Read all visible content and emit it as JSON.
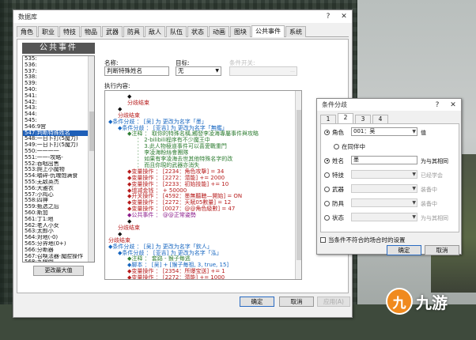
{
  "main_window": {
    "title": "数据库",
    "tabs": [
      "角色",
      "职业",
      "特技",
      "物品",
      "武器",
      "防具",
      "敌人",
      "队伍",
      "状态",
      "动画",
      "图块",
      "公共事件",
      "系统"
    ],
    "selected_tab": "公共事件",
    "list_header": "公共事件",
    "list_items": [
      "535:",
      "536:",
      "537:",
      "538:",
      "539:",
      "540:",
      "541:",
      "542:",
      "543:",
      "544:",
      "545:",
      "546:9宫",
      "547:判断特殊姓名",
      "548:一日卜打(5魔力)",
      "549:一日卜打(5魔力)",
      "550:一一一一",
      "551:一一-攻略-",
      "552:吞咽出售",
      "553:爬上小魔物",
      "554:嚼碎-仇魂饱满食",
      "555:无敌英杰",
      "556:大雅衣",
      "557:小鸡心",
      "558:四神",
      "559:甄选之后",
      "560:斯加",
      "561:丁1:地",
      "562:老人小女",
      "563:太郎小",
      "564:对地(-0)",
      "565:分界地(0+)",
      "566:分断器",
      "567:召唤法器·魔腔操作",
      "568:九曜倒",
      "569:尖原",
      "570:星图敏感",
      "571:宇宙之外人院",
      "572:中化·小阵",
      "573:倍然野宽用"
    ],
    "selected_list_index": 12,
    "change_max_label": "更改最大值",
    "name_label": "名称:",
    "name_value": "判断特殊姓名",
    "trigger_label": "目标:",
    "trigger_value": "无",
    "switch_label": "条件开关:",
    "content_label": "执行内容:",
    "code_lines": [
      {
        "t": "◆",
        "c": "#111",
        "i": 4
      },
      {
        "t": "分歧结束",
        "c": "#b71c1c",
        "i": 4
      },
      {
        "t": "◆",
        "c": "#111",
        "i": 2
      },
      {
        "t": "分歧结束",
        "c": "#b71c1c",
        "i": 2
      },
      {
        "t": "◆条件分歧 ： [吴] 为 更改为名字「墨」",
        "c": "#1565c0",
        "i": 0
      },
      {
        "t": "◆条件分歧 ： [亚吉] 为 更改为名字「無艦」",
        "c": "#1565c0",
        "i": 2
      },
      {
        "t": "◆注释 ： 取你的特殊名稱,觸發李凌海專屬事件與攻略",
        "c": "#2e7d32",
        "i": 4
      },
      {
        "t": "： 2-bilibili程序有不少魔王中",
        "c": "#2e7d32",
        "i": 6
      },
      {
        "t": "： 3.此人物極道事件可以喜愛戰重門",
        "c": "#2e7d32",
        "i": 6
      },
      {
        "t": "： 李凌海粉絲會團隊",
        "c": "#2e7d32",
        "i": 6
      },
      {
        "t": "： 如果有李凌海去世其他特殊名字的改",
        "c": "#2e7d32",
        "i": 6
      },
      {
        "t": "： 而且你現的武器亦消失",
        "c": "#2e7d32",
        "i": 6
      },
      {
        "t": "◆变量操作 ： [2234：角色攻撃] = 34",
        "c": "#b71c1c",
        "i": 4
      },
      {
        "t": "◆变量操作 ： [2272：潜能] += 2000",
        "c": "#b71c1c",
        "i": 4
      },
      {
        "t": "◆变量操作 ： [2233：初始技能] += 10",
        "c": "#b71c1c",
        "i": 4
      },
      {
        "t": "◆增减金钱 ： + 50000",
        "c": "#b71c1c",
        "i": 4
      },
      {
        "t": "◆开关操作 ： [4592：墨無聽聴—開始] = ON",
        "c": "#b71c1c",
        "i": 4
      },
      {
        "t": "◆变量操作 ： [2272：天賦05數量] = 12",
        "c": "#b71c1c",
        "i": 4
      },
      {
        "t": "◆变量操作 ： [0027：@@角色級數] = 47",
        "c": "#b71c1c",
        "i": 4
      },
      {
        "t": "◆公共事件 ： @@正常姿勢",
        "c": "#8b1a8b",
        "i": 4
      },
      {
        "t": "◆",
        "c": "#111",
        "i": 4
      },
      {
        "t": "分歧结束",
        "c": "#b71c1c",
        "i": 2
      },
      {
        "t": "◆",
        "c": "#111",
        "i": 2
      },
      {
        "t": "分歧结束",
        "c": "#b71c1c",
        "i": 0
      },
      {
        "t": "◆条件分歧 ： [吴] 为 更改为名字「欽人」",
        "c": "#1565c0",
        "i": 0
      },
      {
        "t": "◆条件分歧 ： [亚吉] 为 更改为名字「泓」",
        "c": "#1565c0",
        "i": 2
      },
      {
        "t": "◆注释 ： 套路 - 猴子毎逃",
        "c": "#2e7d32",
        "i": 4
      },
      {
        "t": "◆脚本 ： [吴] + [猴子毎祖, 3, true, 15]",
        "c": "#1565c0",
        "i": 4
      },
      {
        "t": "◆变量操作 ： [2354：所爆宝送] += 1",
        "c": "#b71c1c",
        "i": 4
      },
      {
        "t": "◆变量操作 ： [2272：潜能] += 1000",
        "c": "#b71c1c",
        "i": 4
      }
    ],
    "ok_label": "确定",
    "cancel_label": "取消",
    "apply_label": "应用(A)"
  },
  "cond_dialog": {
    "title": "条件分歧",
    "tabs": [
      "1",
      "2",
      "3",
      "4"
    ],
    "selected_tab": "2",
    "rows": [
      {
        "label": "角色",
        "value": "001：吴",
        "suffix": "值",
        "on": true,
        "enabled": true
      },
      {
        "label": "在同伴中",
        "on": false,
        "enabled": true
      },
      {
        "label": "姓名",
        "value": "墨",
        "suffix": "为与其相同",
        "on": true,
        "enabled": true
      },
      {
        "label": "特技",
        "value": "",
        "suffix": "已经学会",
        "on": false,
        "enabled": false
      },
      {
        "label": "武器",
        "value": "",
        "suffix": "装备中",
        "on": false,
        "enabled": false
      },
      {
        "label": "防具",
        "value": "",
        "suffix": "装备中",
        "on": false,
        "enabled": false
      },
      {
        "label": "状态",
        "value": "",
        "suffix": "为与其相同",
        "on": false,
        "enabled": false
      }
    ],
    "else_check": "当条件不符合的场合时的设置",
    "ok_label": "确定",
    "cancel_label": "取消"
  },
  "watermark": {
    "glyph": "九",
    "text": "九游"
  }
}
